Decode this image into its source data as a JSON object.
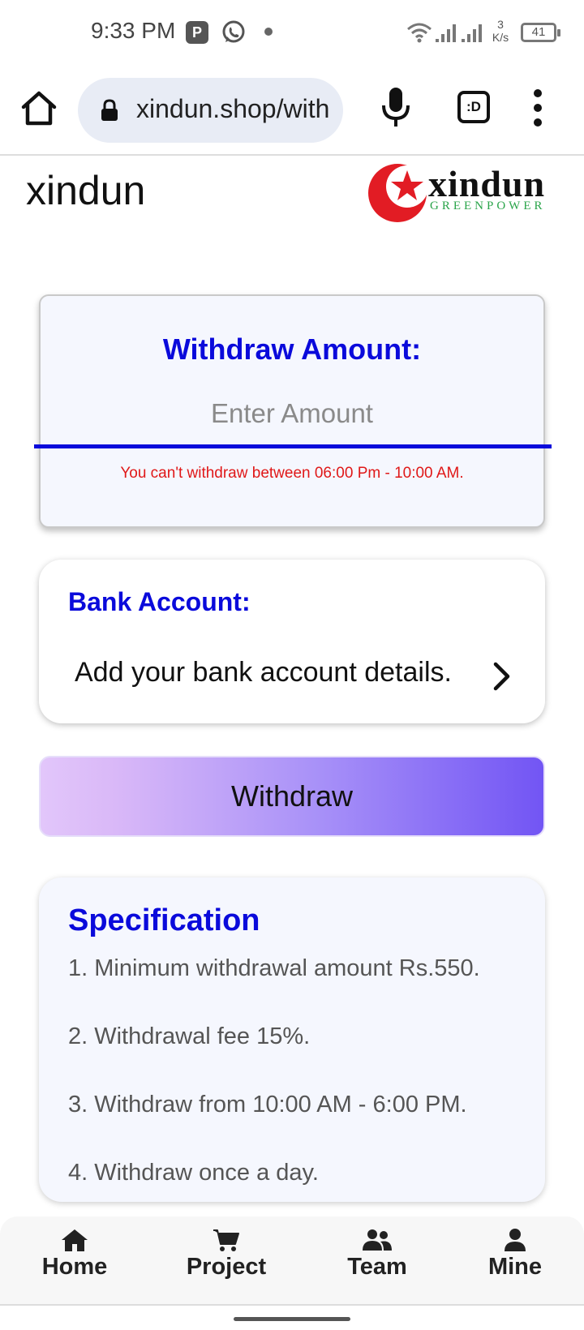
{
  "status_bar": {
    "time": "9:33 PM",
    "speed_value": "3",
    "speed_unit": "K/s",
    "battery": "41"
  },
  "browser": {
    "url": "xindun.shop/withdraw",
    "tabs_label": ":D"
  },
  "header": {
    "site_title": "xindun",
    "logo_text": "xindun",
    "logo_subtext": "GREENPOWER",
    "logo_color": "#e21c24"
  },
  "withdraw_card": {
    "title": "Withdraw Amount:",
    "input_value": "",
    "input_placeholder": "Enter Amount",
    "warning": "You can't withdraw between 06:00 Pm - 10:00 AM."
  },
  "bank_card": {
    "title": "Bank Account:",
    "link_text": "Add your bank account details."
  },
  "withdraw_button": {
    "label": "Withdraw"
  },
  "specification": {
    "title": "Specification",
    "items": [
      "1. Minimum withdrawal amount Rs.550.",
      "2. Withdrawal fee 15%.",
      "3. Withdraw from 10:00 AM - 6:00 PM.",
      "4. Withdraw once a day."
    ]
  },
  "bottom_nav": {
    "items": [
      {
        "label": "Home",
        "icon": "home-icon"
      },
      {
        "label": "Project",
        "icon": "cart-icon"
      },
      {
        "label": "Team",
        "icon": "users-icon"
      },
      {
        "label": "Mine",
        "icon": "user-icon"
      }
    ]
  },
  "colors": {
    "accent": "#0a0adb",
    "warning": "#e01818",
    "button_gradient_start": "#e2c6fa",
    "button_gradient_end": "#7255f4"
  }
}
